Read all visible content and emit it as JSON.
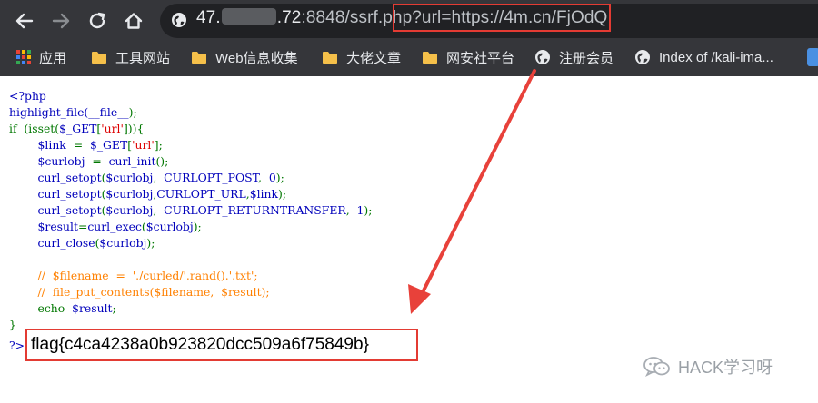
{
  "browser": {
    "url": {
      "host_start": "47.",
      "host_end": ".72",
      "port_path": ":8848/ssrf.php",
      "query": "?url=https://4m.cn/FjOdQ"
    },
    "bookmarks": [
      {
        "label": "应用",
        "icon": "apps-grid-icon"
      },
      {
        "label": "工具网站",
        "icon": "folder-icon"
      },
      {
        "label": "Web信息收集",
        "icon": "folder-icon"
      },
      {
        "label": "大佬文章",
        "icon": "folder-icon"
      },
      {
        "label": "网安社平台",
        "icon": "folder-icon"
      },
      {
        "label": "注册会员",
        "icon": "globe-icon"
      },
      {
        "label": "Index of /kali-ima...",
        "icon": "globe-icon"
      }
    ],
    "colors": {
      "toolbar": "#35363a",
      "omnibox": "#202124",
      "highlight": "#e33b33",
      "folder": "#f5c04a"
    }
  },
  "page": {
    "code_lines": [
      [
        {
          "t": "<?php",
          "c": "def"
        }
      ],
      [
        {
          "t": "highlight_file(",
          "c": "def"
        },
        {
          "t": "__file__",
          "c": "def"
        },
        {
          "t": ");",
          "c": "kw"
        }
      ],
      [
        {
          "t": "if  (",
          "c": "kw"
        },
        {
          "t": "isset",
          "c": "kw"
        },
        {
          "t": "(",
          "c": "kw"
        },
        {
          "t": "$_GET",
          "c": "def"
        },
        {
          "t": "[",
          "c": "kw"
        },
        {
          "t": "'url'",
          "c": "str"
        },
        {
          "t": "])){",
          "c": "kw"
        }
      ],
      [
        {
          "t": "        $link  ",
          "c": "def"
        },
        {
          "t": "=  ",
          "c": "kw"
        },
        {
          "t": "$_GET",
          "c": "def"
        },
        {
          "t": "[",
          "c": "kw"
        },
        {
          "t": "'url'",
          "c": "str"
        },
        {
          "t": "];",
          "c": "kw"
        }
      ],
      [
        {
          "t": "        $curlobj  ",
          "c": "def"
        },
        {
          "t": "=  ",
          "c": "kw"
        },
        {
          "t": "curl_init",
          "c": "def"
        },
        {
          "t": "();",
          "c": "kw"
        }
      ],
      [
        {
          "t": "        curl_setopt",
          "c": "def"
        },
        {
          "t": "(",
          "c": "kw"
        },
        {
          "t": "$curlobj",
          "c": "def"
        },
        {
          "t": ",  ",
          "c": "kw"
        },
        {
          "t": "CURLOPT_POST",
          "c": "def"
        },
        {
          "t": ",  ",
          "c": "kw"
        },
        {
          "t": "0",
          "c": "def"
        },
        {
          "t": ");",
          "c": "kw"
        }
      ],
      [
        {
          "t": "        curl_setopt",
          "c": "def"
        },
        {
          "t": "(",
          "c": "kw"
        },
        {
          "t": "$curlobj",
          "c": "def"
        },
        {
          "t": ",",
          "c": "kw"
        },
        {
          "t": "CURLOPT_URL",
          "c": "def"
        },
        {
          "t": ",",
          "c": "kw"
        },
        {
          "t": "$link",
          "c": "def"
        },
        {
          "t": ");",
          "c": "kw"
        }
      ],
      [
        {
          "t": "        curl_setopt",
          "c": "def"
        },
        {
          "t": "(",
          "c": "kw"
        },
        {
          "t": "$curlobj",
          "c": "def"
        },
        {
          "t": ",  ",
          "c": "kw"
        },
        {
          "t": "CURLOPT_RETURNTRANSFER",
          "c": "def"
        },
        {
          "t": ",  ",
          "c": "kw"
        },
        {
          "t": "1",
          "c": "def"
        },
        {
          "t": ");",
          "c": "kw"
        }
      ],
      [
        {
          "t": "        $result",
          "c": "def"
        },
        {
          "t": "=",
          "c": "kw"
        },
        {
          "t": "curl_exec",
          "c": "def"
        },
        {
          "t": "(",
          "c": "kw"
        },
        {
          "t": "$curlobj",
          "c": "def"
        },
        {
          "t": ");",
          "c": "kw"
        }
      ],
      [
        {
          "t": "        curl_close",
          "c": "def"
        },
        {
          "t": "(",
          "c": "kw"
        },
        {
          "t": "$curlobj",
          "c": "def"
        },
        {
          "t": ");",
          "c": "kw"
        }
      ],
      [
        {
          "t": "",
          "c": "def"
        }
      ],
      [
        {
          "t": "        //  $filename  =  './curled/'.rand().'.txt';",
          "c": "cmt"
        }
      ],
      [
        {
          "t": "        //  file_put_contents($filename,  $result);",
          "c": "cmt"
        }
      ],
      [
        {
          "t": "        echo  ",
          "c": "kw"
        },
        {
          "t": "$result",
          "c": "def"
        },
        {
          "t": ";",
          "c": "kw"
        }
      ],
      [
        {
          "t": "}",
          "c": "kw"
        }
      ]
    ],
    "prompt": "?>",
    "flag": "flag{c4ca4238a0b923820dcc509a6f75849b}",
    "colors": {
      "php_default": "#0000bb",
      "php_keyword": "#007700",
      "php_string": "#dd0000",
      "php_comment": "#ff8000"
    }
  },
  "watermark": {
    "text": "HACK学习呀",
    "icon": "wechat-icon"
  }
}
